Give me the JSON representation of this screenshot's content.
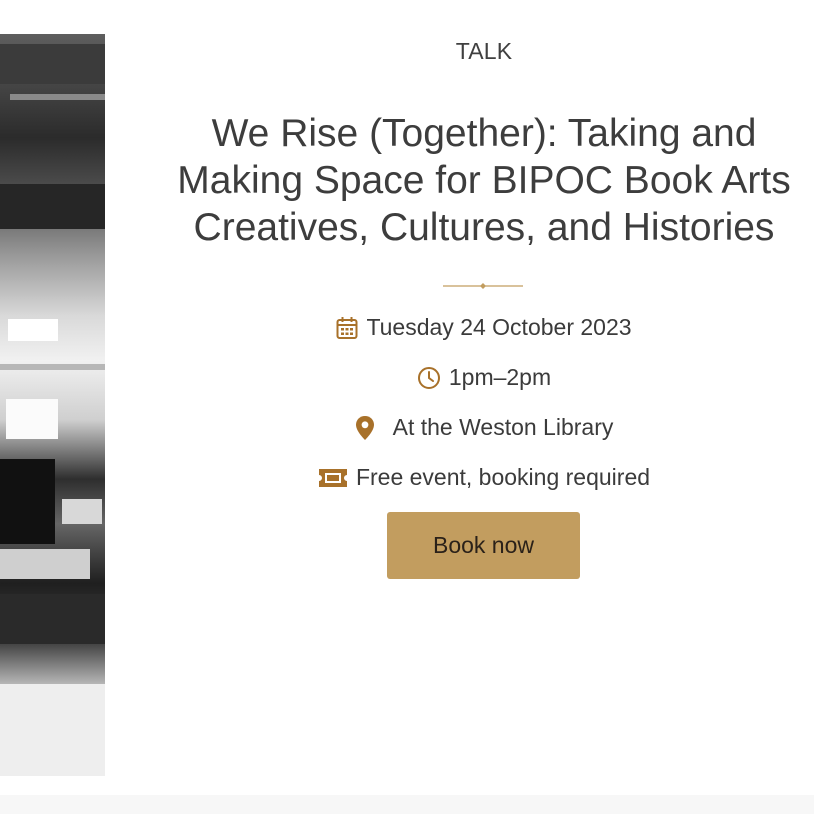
{
  "event": {
    "category": "TALK",
    "title_lines": [
      "We Rise (Together): Taking and",
      "Making Space for BIPOC Book Arts",
      "Creatives, Cultures, and Histories"
    ],
    "date": "Tuesday 24 October 2023",
    "time": "1pm–2pm",
    "location": "At the Weston Library",
    "price": "Free event, booking required",
    "book_label": "Book now"
  },
  "icons": {
    "date": "calendar-icon",
    "time": "clock-icon",
    "location": "map-pin-icon",
    "price": "ticket-icon",
    "divider": "diamond-divider"
  },
  "colors": {
    "accent": "#c29d5f",
    "icon": "#a8712a",
    "text": "#3d3d3d"
  }
}
